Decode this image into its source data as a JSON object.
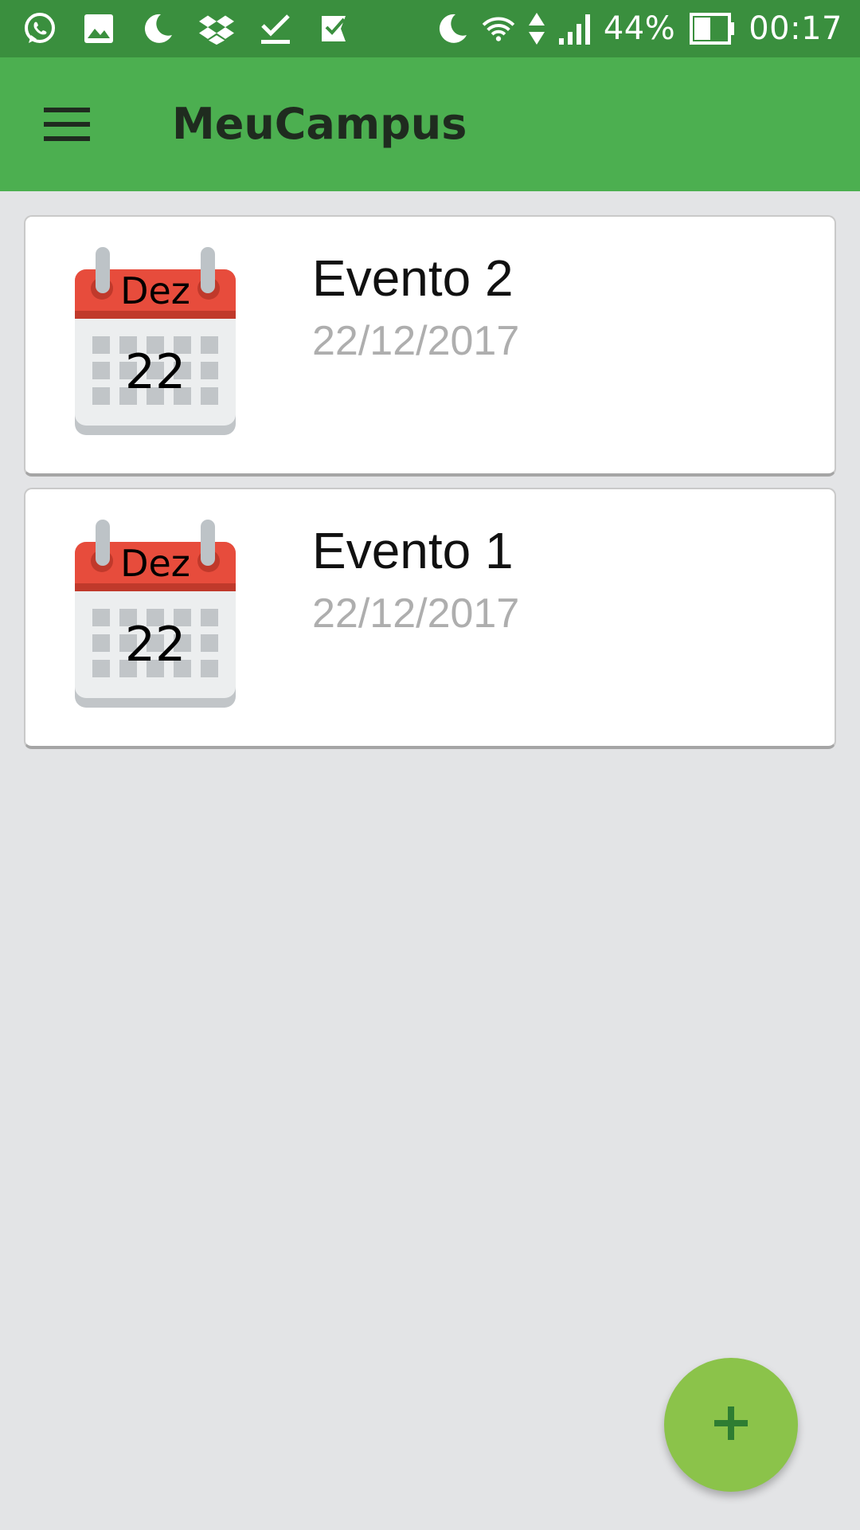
{
  "status_bar": {
    "left_icons": [
      "whatsapp-icon",
      "image-icon",
      "moon-icon",
      "dropbox-icon",
      "download-done-icon",
      "task-check-icon"
    ],
    "right_icons": [
      "moon-icon",
      "wifi-icon",
      "data-arrows-icon",
      "signal-icon",
      "battery-icon"
    ],
    "battery_percent": "44%",
    "time": "00:17"
  },
  "app_bar": {
    "menu_icon": "hamburger-menu-icon",
    "title": "MeuCampus",
    "color": "#4caf50"
  },
  "events": [
    {
      "month": "Dez",
      "day": "22",
      "title": "Evento 2",
      "date": "22/12/2017"
    },
    {
      "month": "Dez",
      "day": "22",
      "title": "Evento 1",
      "date": "22/12/2017"
    }
  ],
  "fab": {
    "icon": "plus-icon",
    "color": "#8bc34a"
  }
}
